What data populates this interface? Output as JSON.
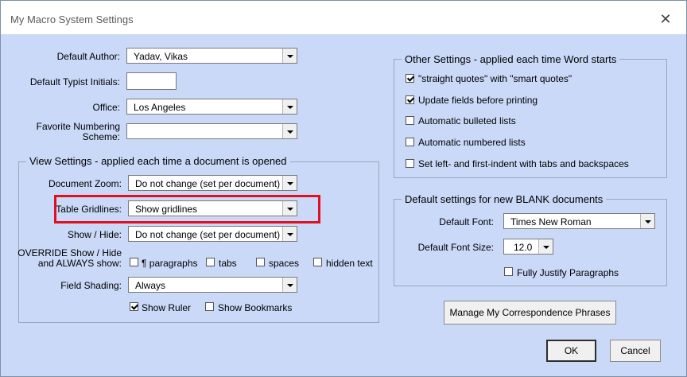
{
  "window": {
    "title": "My Macro System Settings",
    "close_glyph": "✕"
  },
  "general": {
    "default_author": {
      "label": "Default Author:",
      "value": "Yadav, Vikas"
    },
    "default_typist_initials": {
      "label": "Default Typist Initials:",
      "value": ""
    },
    "office": {
      "label": "Office:",
      "value": "Los Angeles"
    },
    "favorite_numbering_scheme": {
      "label_line1": "Favorite Numbering",
      "label_line2": "Scheme:",
      "value": ""
    }
  },
  "view_settings": {
    "title": "View Settings - applied each time a document is opened",
    "document_zoom": {
      "label": "Document Zoom:",
      "value": "Do not change (set per document)"
    },
    "table_gridlines": {
      "label": "Table Gridlines:",
      "value": "Show gridlines"
    },
    "show_hide": {
      "label": "Show / Hide:",
      "value": "Do not change (set per document)"
    },
    "override": {
      "label_line1": "OVERRIDE Show / Hide",
      "label_line2": "and ALWAYS show:",
      "options": [
        {
          "label": "¶ paragraphs",
          "checked": false
        },
        {
          "label": "tabs",
          "checked": false
        },
        {
          "label": "spaces",
          "checked": false
        },
        {
          "label": "hidden text",
          "checked": false
        }
      ]
    },
    "field_shading": {
      "label": "Field Shading:",
      "value": "Always"
    },
    "show_ruler": {
      "label": "Show Ruler",
      "checked": true
    },
    "show_bookmarks": {
      "label": "Show Bookmarks",
      "checked": false
    }
  },
  "other_settings": {
    "title": "Other Settings - applied each time Word starts",
    "options": [
      {
        "label": "\"straight quotes\" with \"smart quotes\"",
        "checked": true
      },
      {
        "label": "Update fields before printing",
        "checked": true
      },
      {
        "label": "Automatic bulleted lists",
        "checked": false
      },
      {
        "label": "Automatic numbered lists",
        "checked": false
      },
      {
        "label": "Set left- and first-indent with tabs and backspaces",
        "checked": false
      }
    ]
  },
  "blank_defaults": {
    "title": "Default settings for new BLANK documents",
    "default_font": {
      "label": "Default Font:",
      "value": "Times New Roman"
    },
    "default_font_size": {
      "label": "Default Font Size:",
      "value": "12.0"
    },
    "fully_justify": {
      "label": "Fully Justify Paragraphs",
      "checked": false
    }
  },
  "buttons": {
    "manage_phrases": "Manage My Correspondence Phrases",
    "ok": "OK",
    "cancel": "Cancel"
  },
  "colors": {
    "dialog_background": "#c9d9f7",
    "highlight_border": "#e01020"
  }
}
